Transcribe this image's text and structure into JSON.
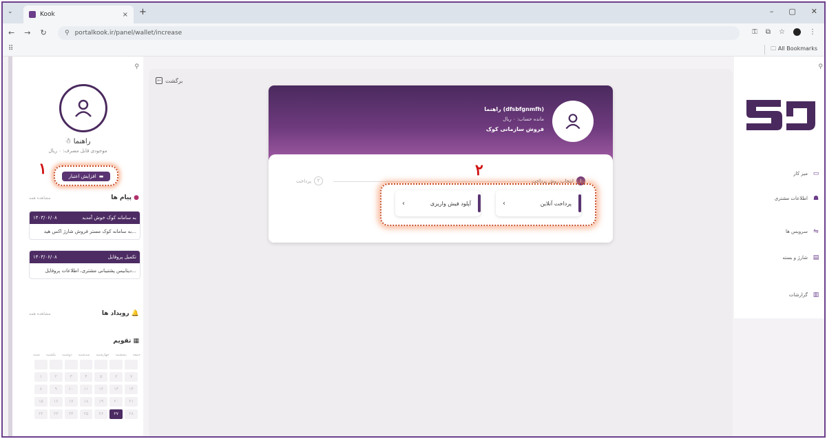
{
  "browser": {
    "tab_title": "Kook",
    "url": "portalkook.ir/panel/wallet/increase",
    "all_bookmarks": "All Bookmarks"
  },
  "left_sidebar": {
    "user_name": "راهنما",
    "balance": "موجودی قابل مصرف: ۰ ریال",
    "topup_label": "افزایش اعتبار",
    "callout_number": "۱",
    "messages_title": "پیام ها",
    "see_all": "مشاهده همه",
    "messages": [
      {
        "title": "به سامانه کوک خوش آمدید",
        "date": "۱۴۰۳/۰۶/۰۸",
        "body": "به سامانه کوک مستر فروش شارژ اکس هید..."
      },
      {
        "title": "تکمیل پروفایل",
        "date": "۱۴۰۳/۰۶/۰۸",
        "body": "دیتابیس پشتیبانی مشتری، اطلاعات پروفایل..."
      }
    ],
    "events_title": "رویداد ها",
    "calendar_title": "تقویم",
    "weekdays": [
      "شنبه",
      "یکشنبه",
      "دوشنبه",
      "سه‌شنبه",
      "چهارشنبه",
      "پنجشنبه",
      "جمعه"
    ],
    "calendar_days": [
      "",
      "",
      "",
      "",
      "",
      "",
      "",
      "۱",
      "۲",
      "۳",
      "۴",
      "۵",
      "۶",
      "۷",
      "۸",
      "۹",
      "۱۰",
      "۱۱",
      "۱۲",
      "۱۳",
      "۱۴",
      "۱۵",
      "۱۶",
      "۱۷",
      "۱۸",
      "۱۹",
      "۲۰",
      "۲۱",
      "۲۲",
      "۲۳",
      "۲۴",
      "۲۵",
      "۲۶",
      "۲۷",
      "۲۸"
    ],
    "today_index": 33
  },
  "main": {
    "back_label": "برگشت",
    "card": {
      "user_line": "راهنما (dfsbfgnmfh)",
      "balance_line": "مانده حساب: ۰ ریال",
      "org_line": "فروش سازمانی کوک"
    },
    "steps": {
      "choose": "انتخاب روش پرداخت",
      "choose_num": "۱",
      "pay": "پرداخت",
      "pay_num": "۲"
    },
    "callout_number": "۲",
    "options": {
      "online": "پرداخت آنلاین",
      "upload": "آپلود فیش واریزی"
    }
  },
  "right_sidebar": {
    "logo_text": "کوک",
    "nav": [
      {
        "label": "میز کار",
        "icon": "desktop-icon"
      },
      {
        "label": "اطلاعات مشتری",
        "icon": "user-icon"
      },
      {
        "label": "سرویس ها",
        "icon": "services-icon"
      },
      {
        "label": "شارژ و بسته",
        "icon": "package-icon"
      },
      {
        "label": "گزارشات",
        "icon": "report-icon"
      }
    ]
  },
  "colors": {
    "brand": "#4a2a5e",
    "accent": "#6e3a7d",
    "callout_red": "#d01010",
    "highlight_orange": "#c74a25"
  }
}
